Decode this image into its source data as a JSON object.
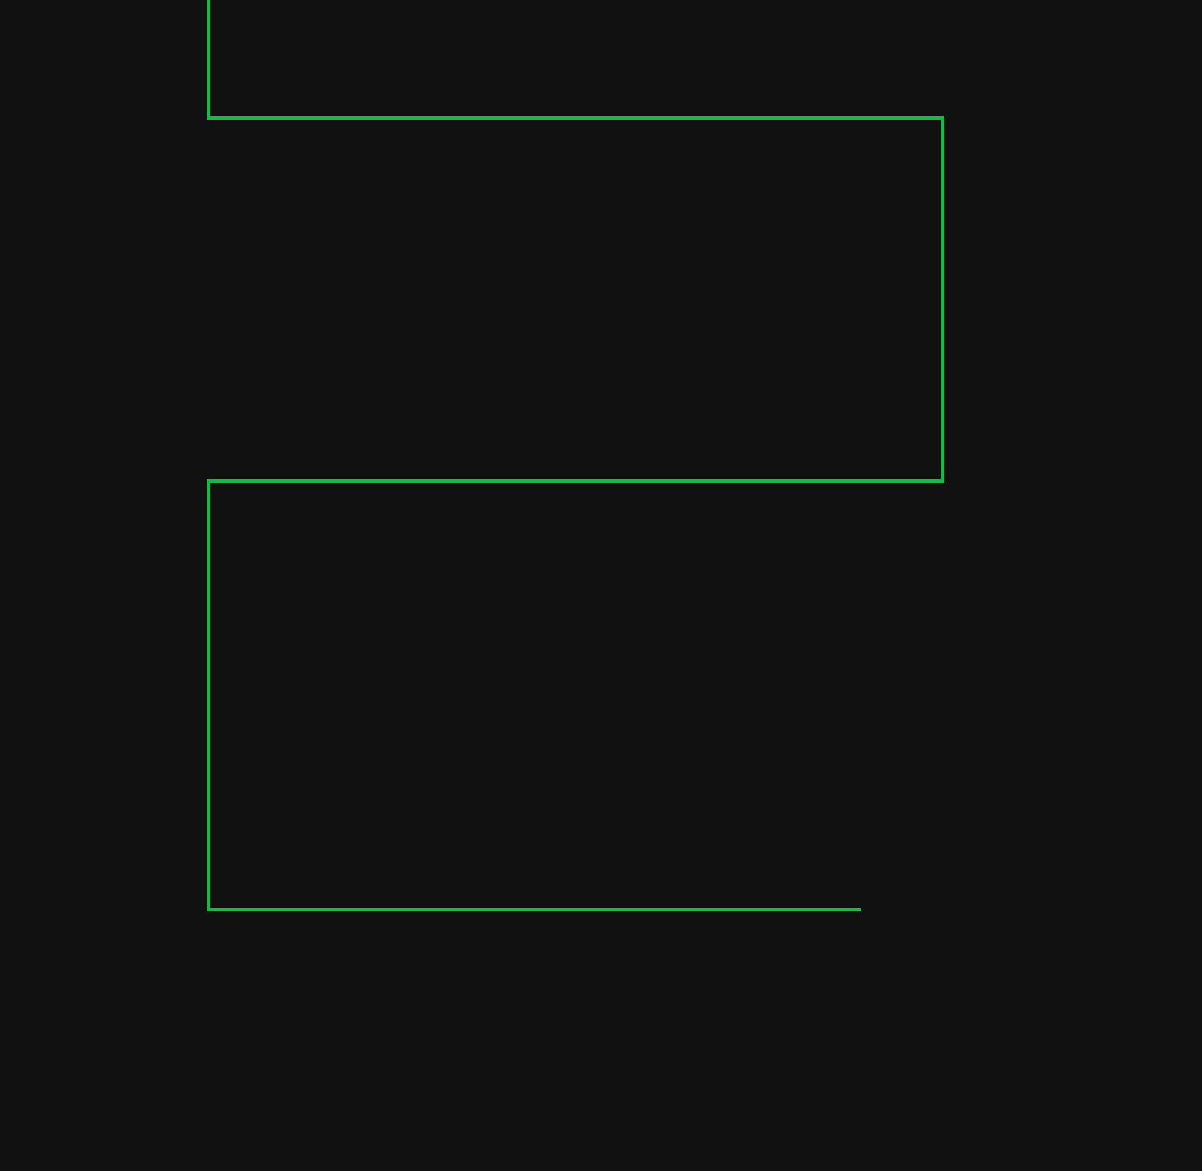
{
  "canvas": {
    "background_color": "#111111"
  },
  "path": {
    "stroke_color": "#1ab84a",
    "description_icon": "serpentine-line"
  }
}
